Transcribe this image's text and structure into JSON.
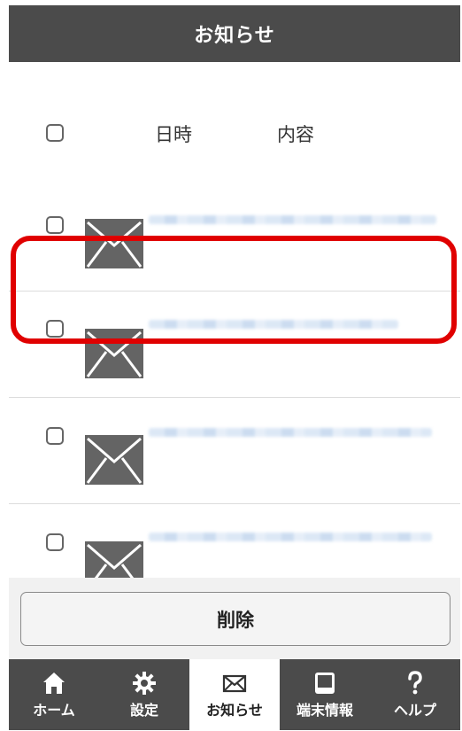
{
  "header": {
    "title": "お知らせ"
  },
  "list": {
    "columns": {
      "datetime": "日時",
      "content": "内容"
    }
  },
  "actions": {
    "delete_label": "削除"
  },
  "nav": {
    "items": [
      {
        "label": "ホーム",
        "icon": "home-icon"
      },
      {
        "label": "設定",
        "icon": "gear-icon"
      },
      {
        "label": "お知らせ",
        "icon": "mail-icon",
        "active": true
      },
      {
        "label": "端末情報",
        "icon": "device-icon"
      },
      {
        "label": "ヘルプ",
        "icon": "help-icon"
      }
    ]
  },
  "colors": {
    "header_bg": "#4b4b4b",
    "highlight": "#e00000",
    "envelope": "#646464"
  }
}
